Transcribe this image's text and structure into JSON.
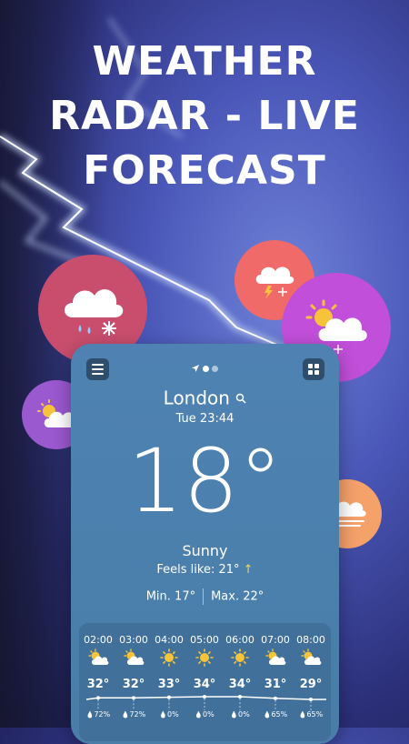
{
  "headline": {
    "line1": "WEATHER",
    "line2": "RADAR - LIVE",
    "line3": "FORECAST"
  },
  "bubbles": [
    {
      "icon": "cloud-snow-rain-icon",
      "color": "#c94e6e"
    },
    {
      "icon": "cloud-thunder-snow-icon",
      "color": "#f06a6a"
    },
    {
      "icon": "sun-cloud-snow-icon",
      "color": "#c14fd9"
    },
    {
      "icon": "sun-cloud-icon",
      "color": "#9b59d0"
    },
    {
      "icon": "cloud-fog-icon",
      "color": "#f5a16a"
    }
  ],
  "app": {
    "city": "London",
    "datetime": "Tue 23:44",
    "temperature": "18°",
    "condition": "Sunny",
    "feels_like": "Feels like: 21°",
    "feels_arrow": "↑",
    "min": "Min. 17°",
    "max": "Max. 22°",
    "hourly": [
      {
        "time": "02:00",
        "icon": "sun-cloud-icon",
        "temp": "32°",
        "rain": "72%"
      },
      {
        "time": "03:00",
        "icon": "sun-cloud-icon",
        "temp": "32°",
        "rain": "72%"
      },
      {
        "time": "04:00",
        "icon": "sun-icon",
        "temp": "33°",
        "rain": "0%"
      },
      {
        "time": "05:00",
        "icon": "sun-icon",
        "temp": "34°",
        "rain": "0%"
      },
      {
        "time": "06:00",
        "icon": "sun-icon",
        "temp": "34°",
        "rain": "0%"
      },
      {
        "time": "07:00",
        "icon": "sun-cloud-icon",
        "temp": "31°",
        "rain": "65%"
      },
      {
        "time": "08:00",
        "icon": "sun-cloud-icon",
        "temp": "29°",
        "rain": "65%"
      }
    ]
  },
  "colors": {
    "sun": "#f6c33a",
    "card_bg": "#4f82b2",
    "hourly_bg": "#41709b"
  }
}
